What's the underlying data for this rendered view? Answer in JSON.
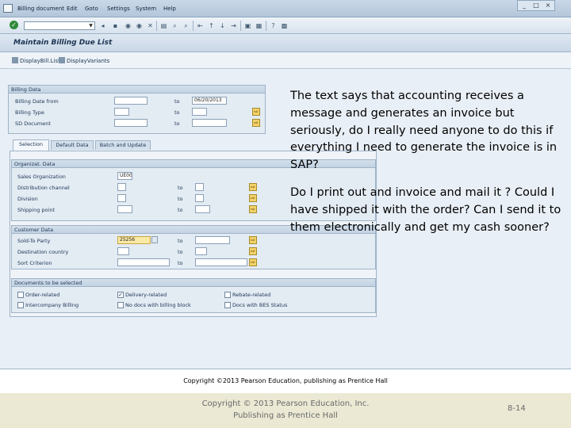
{
  "menubar": {
    "items": [
      "Billing document",
      "Edit",
      "Goto",
      "Settings",
      "System",
      "Help"
    ]
  },
  "window_controls": {
    "minimize": "_",
    "maximize": "□",
    "close": "×"
  },
  "page_title": "Maintain Billing Due List",
  "app_toolbar": {
    "display_bill_list": "DisplayBill.List",
    "display_variants": "DisplayVariants"
  },
  "billing_data": {
    "title": "Billing Data",
    "rows": [
      {
        "label": "Billing Date from",
        "from": "",
        "to_label": "to",
        "to": "06/20/2013"
      },
      {
        "label": "Billing Type",
        "from": "",
        "to_label": "to",
        "to": ""
      },
      {
        "label": "SD Document",
        "from": "",
        "to_label": "to",
        "to": ""
      }
    ]
  },
  "tabs": [
    "Selection",
    "Default Data",
    "Batch and Update"
  ],
  "organizat_data": {
    "title": "Organizat. Data",
    "rows": [
      {
        "label": "Sales Organization",
        "from": "UE00",
        "to_label": "",
        "to": ""
      },
      {
        "label": "Distribution channel",
        "from": "",
        "to_label": "to",
        "to": ""
      },
      {
        "label": "Division",
        "from": "",
        "to_label": "to",
        "to": ""
      },
      {
        "label": "Shipping point",
        "from": "",
        "to_label": "to",
        "to": ""
      }
    ]
  },
  "customer_data": {
    "title": "Customer Data",
    "rows": [
      {
        "label": "Sold-To Party",
        "from": "25256",
        "to_label": "to",
        "to": ""
      },
      {
        "label": "Destination country",
        "from": "",
        "to_label": "to",
        "to": ""
      },
      {
        "label": "Sort Criterion",
        "from": "",
        "to_label": "to",
        "to": ""
      }
    ]
  },
  "documents": {
    "title": "Documents to be selected",
    "items": [
      {
        "label": "Order-related",
        "checked": false
      },
      {
        "label": "Delivery-related",
        "checked": true
      },
      {
        "label": "Rebate-related",
        "checked": false
      },
      {
        "label": "Intercompany Billing",
        "checked": false
      },
      {
        "label": "No docs with billing block",
        "checked": false
      },
      {
        "label": "Docs with BES Status",
        "checked": false
      }
    ]
  },
  "note": {
    "paragraph1": "The text says that accounting receives a message and generates an invoice but seriously, do I really need anyone to do this if everything I need to generate the invoice is in SAP?",
    "paragraph2": "Do I print out and invoice and mail it ?  Could I have shipped it with the order?  Can I send it to them electronically and get my cash sooner?"
  },
  "screenshot_copyright": "Copyright ©2013 Pearson Education, publishing as Prentice Hall",
  "footer": {
    "line1": "Copyright © 2013 Pearson Education, Inc.",
    "line2": "Publishing as Prentice Hall",
    "slide_number": "8-14"
  },
  "colors": {
    "accent": "#1b3553",
    "highlight": "#fbe9a6",
    "footer_bg": "#ebe9d4"
  }
}
